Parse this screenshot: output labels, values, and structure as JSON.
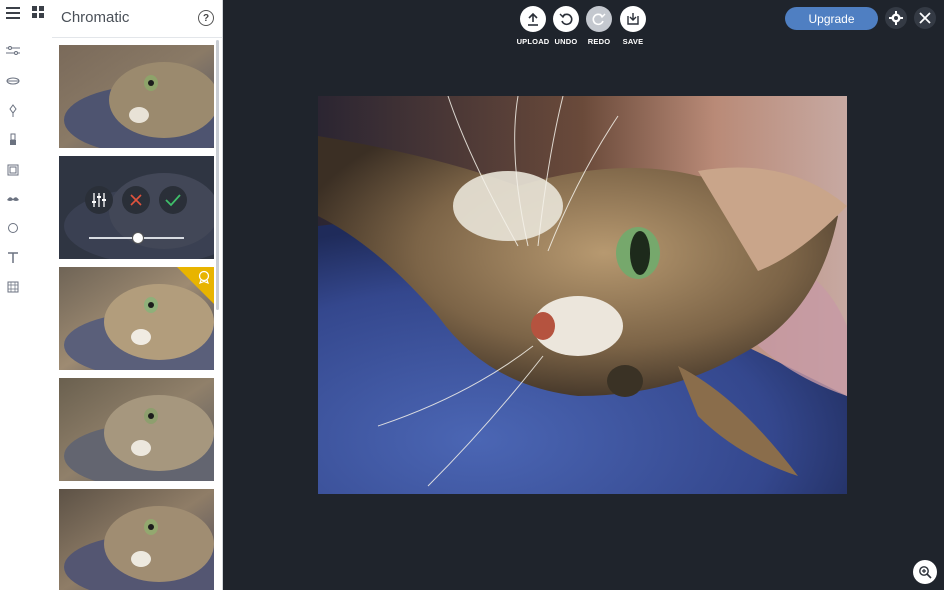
{
  "panel": {
    "title": "Chromatic",
    "help_label": "?"
  },
  "toolbar": {
    "upload_label": "UPLOAD",
    "undo_label": "UNDO",
    "redo_label": "REDO",
    "save_label": "SAVE"
  },
  "header": {
    "upgrade_label": "Upgrade"
  },
  "adjust": {
    "intensity": 0.5
  },
  "colors": {
    "accent": "#4f7fc2",
    "premium": "#e8b400",
    "confirm": "#3fbf6a",
    "cancel": "#e0533d"
  }
}
